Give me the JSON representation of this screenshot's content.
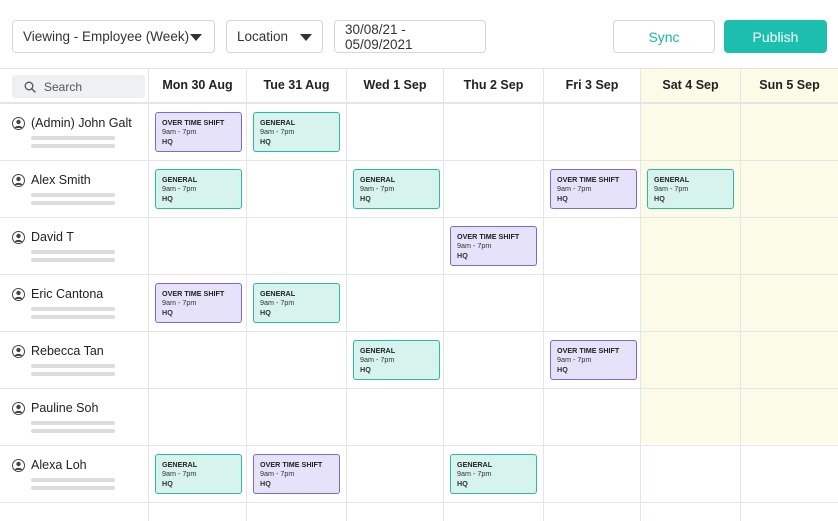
{
  "toolbar": {
    "view_select": "Viewing - Employee (Week)",
    "location_select": "Location",
    "date_range": "30/08/21 - 05/09/2021",
    "sync_label": "Sync",
    "publish_label": "Publish"
  },
  "search": {
    "placeholder": "Search"
  },
  "days": [
    {
      "label": "Mon 30 Aug",
      "weekend": false
    },
    {
      "label": "Tue 31 Aug",
      "weekend": false
    },
    {
      "label": "Wed 1 Sep",
      "weekend": false
    },
    {
      "label": "Thu 2 Sep",
      "weekend": false
    },
    {
      "label": "Fri 3 Sep",
      "weekend": false
    },
    {
      "label": "Sat 4 Sep",
      "weekend": true
    },
    {
      "label": "Sun 5 Sep",
      "weekend": true
    }
  ],
  "employees": [
    {
      "name": "(Admin) John Galt",
      "shifts": [
        {
          "day": 0,
          "type": "overtime",
          "title": "OVER TIME SHIFT",
          "time": "9am - 7pm",
          "location": "HQ"
        },
        {
          "day": 1,
          "type": "general",
          "title": "GENERAL",
          "time": "9am - 7pm",
          "location": "HQ"
        }
      ]
    },
    {
      "name": "Alex Smith",
      "shifts": [
        {
          "day": 0,
          "type": "general",
          "title": "GENERAL",
          "time": "9am - 7pm",
          "location": "HQ"
        },
        {
          "day": 2,
          "type": "general",
          "title": "GENERAL",
          "time": "9am - 7pm",
          "location": "HQ"
        },
        {
          "day": 4,
          "type": "overtime",
          "title": "OVER TIME SHIFT",
          "time": "9am - 7pm",
          "location": "HQ"
        },
        {
          "day": 5,
          "type": "general",
          "title": "GENERAL",
          "time": "9am - 7pm",
          "location": "HQ"
        }
      ]
    },
    {
      "name": "David T",
      "shifts": [
        {
          "day": 3,
          "type": "overtime",
          "title": "OVER TIME SHIFT",
          "time": "9am - 7pm",
          "location": "HQ"
        }
      ]
    },
    {
      "name": "Eric Cantona",
      "shifts": [
        {
          "day": 0,
          "type": "overtime",
          "title": "OVER TIME SHIFT",
          "time": "9am - 7pm",
          "location": "HQ"
        },
        {
          "day": 1,
          "type": "general",
          "title": "GENERAL",
          "time": "9am - 7pm",
          "location": "HQ"
        }
      ]
    },
    {
      "name": "Rebecca Tan",
      "shifts": [
        {
          "day": 2,
          "type": "general",
          "title": "GENERAL",
          "time": "9am - 7pm",
          "location": "HQ"
        },
        {
          "day": 4,
          "type": "overtime",
          "title": "OVER TIME SHIFT",
          "time": "9am - 7pm",
          "location": "HQ"
        }
      ]
    },
    {
      "name": "Pauline Soh",
      "shifts": []
    },
    {
      "name": "Alexa Loh",
      "shifts": [
        {
          "day": 0,
          "type": "general",
          "title": "GENERAL",
          "time": "9am - 7pm",
          "location": "HQ"
        },
        {
          "day": 1,
          "type": "overtime",
          "title": "OVER TIME SHIFT",
          "time": "9am - 7pm",
          "location": "HQ"
        },
        {
          "day": 3,
          "type": "general",
          "title": "GENERAL",
          "time": "9am - 7pm",
          "location": "HQ"
        }
      ]
    }
  ],
  "icons": {
    "search": "search-icon",
    "caret": "chevron-down-icon",
    "avatar": "user-avatar-icon"
  },
  "colors": {
    "accent": "#1cbfae",
    "general_fill": "#d7f3ee",
    "general_border": "#2cb8a4",
    "overtime_fill": "#e5e2fa",
    "overtime_border": "#7b6ad3",
    "weekend_bg": "#fbfbe8"
  }
}
